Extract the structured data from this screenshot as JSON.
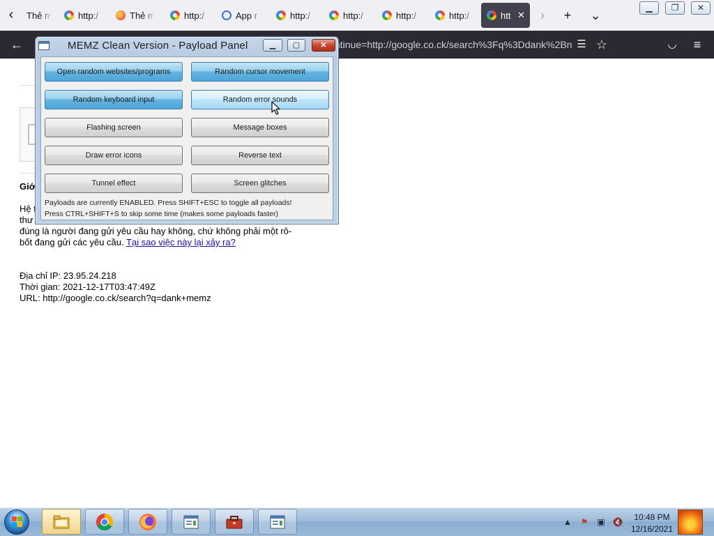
{
  "browser": {
    "tabs": [
      {
        "label": "Thẻ m",
        "icon": "firefox-icon",
        "active": false
      },
      {
        "label": "http:/",
        "icon": "google-icon",
        "active": false
      },
      {
        "label": "Thẻ m",
        "icon": "firefox-icon",
        "active": false
      },
      {
        "label": "http:/",
        "icon": "google-icon",
        "active": false
      },
      {
        "label": "App r",
        "icon": "app-icon",
        "active": false
      },
      {
        "label": "http:/",
        "icon": "google-icon",
        "active": false
      },
      {
        "label": "http:/",
        "icon": "google-icon",
        "active": false
      },
      {
        "label": "http:/",
        "icon": "google-icon",
        "active": false
      },
      {
        "label": "http:/",
        "icon": "google-icon",
        "active": false
      },
      {
        "label": "htt",
        "icon": "google-icon",
        "active": true
      }
    ],
    "url_visible": "ntinue=http://google.co.ck/search%3Fq%3Ddank%2Bn"
  },
  "page": {
    "heading": "Giớ",
    "para1_line1": "Hệ t",
    "para1_line2": "thư",
    "para1_line3": "đúng là người đang gửi yêu cầu hay không, chứ không phải một rô-",
    "para1_line4_text": "bốt đang gửi các yêu cầu.",
    "para1_link": "Tại sao việc này lại xảy ra?",
    "ip_line": "Địa chỉ IP: 23.95.24.218",
    "time_line": "Thời gian: 2021-12-17T03:47:49Z",
    "url_line": "URL: http://google.co.ck/search?q=dank+memz"
  },
  "memz": {
    "title": "MEMZ Clean Version - Payload Panel",
    "buttons": [
      {
        "label": "Open random websites/programs",
        "state": "enabled"
      },
      {
        "label": "Random cursor movement",
        "state": "enabled"
      },
      {
        "label": "Random keyboard input",
        "state": "enabled"
      },
      {
        "label": "Random error sounds",
        "state": "hover"
      },
      {
        "label": "Flashing screen",
        "state": "disabled"
      },
      {
        "label": "Message boxes",
        "state": "disabled"
      },
      {
        "label": "Draw error icons",
        "state": "disabled"
      },
      {
        "label": "Reverse text",
        "state": "disabled"
      },
      {
        "label": "Tunnel effect",
        "state": "disabled"
      },
      {
        "label": "Screen glitches",
        "state": "disabled"
      }
    ],
    "status_line1": "Payloads are currently ENABLED. Press SHIFT+ESC to toggle all payloads!",
    "status_line2": "Press CTRL+SHIFT+S to skip some time (makes some payloads faster)"
  },
  "taskbar": {
    "items": [
      "explorer",
      "chrome",
      "firefox",
      "memz-window",
      "toolbox",
      "memz-window"
    ],
    "clock_time": "10:48 PM",
    "clock_date": "12/16/2021"
  },
  "colors": {
    "firefox_tabstrip": "#f0f0f4",
    "firefox_navbar": "#2b2a33",
    "active_tab": "#42414d",
    "memz_button_on": "#66b3de",
    "link": "#1a0dab"
  }
}
